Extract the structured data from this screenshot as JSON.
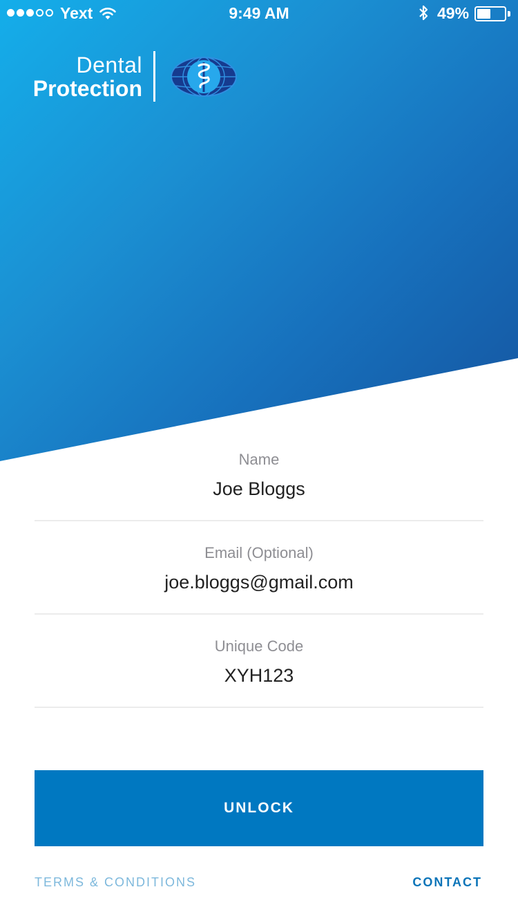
{
  "status_bar": {
    "signal_bars": 5,
    "signal_filled": 3,
    "carrier": "Yext",
    "time": "9:49 AM",
    "battery_percent": "49%",
    "battery_level": 0.49
  },
  "brand": {
    "line1": "Dental",
    "line2": "Protection",
    "logo_icon": "globe-caduceus-icon"
  },
  "form": {
    "name": {
      "label": "Name",
      "value": "Joe Bloggs"
    },
    "email": {
      "label": "Email (Optional)",
      "value": "joe.bloggs@gmail.com"
    },
    "code": {
      "label": "Unique Code",
      "value": "XYH123"
    }
  },
  "actions": {
    "unlock_label": "UNLOCK",
    "terms_label": "TERMS & CONDITIONS",
    "contact_label": "CONTACT"
  },
  "colors": {
    "hero_start": "#14aeea",
    "hero_end": "#15539e",
    "button": "#0078c1",
    "terms_link": "#7db8dc",
    "contact_link": "#0b74b8"
  }
}
